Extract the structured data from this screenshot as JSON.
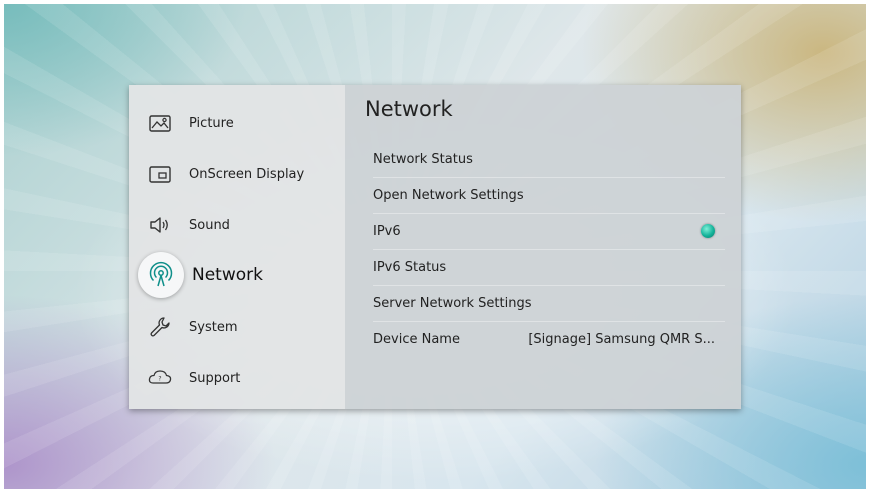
{
  "sidebar": {
    "items": [
      {
        "label": "Picture",
        "icon": "picture-icon"
      },
      {
        "label": "OnScreen Display",
        "icon": "onscreen-display-icon"
      },
      {
        "label": "Sound",
        "icon": "sound-icon"
      },
      {
        "label": "Network",
        "icon": "network-icon",
        "selected": true
      },
      {
        "label": "System",
        "icon": "system-wrench-icon"
      },
      {
        "label": "Support",
        "icon": "support-icon"
      }
    ]
  },
  "content": {
    "title": "Network",
    "rows": [
      {
        "label": "Network Status"
      },
      {
        "label": "Open Network Settings"
      },
      {
        "label": "IPv6",
        "toggle": "on"
      },
      {
        "label": "IPv6 Status"
      },
      {
        "label": "Server Network Settings"
      },
      {
        "label": "Device Name",
        "value": "[Signage] Samsung QMR S..."
      }
    ]
  },
  "colors": {
    "toggle_on": "#14b39a",
    "sidebar_bg": "#e2e4e5",
    "content_bg": "#cdd2d5"
  }
}
